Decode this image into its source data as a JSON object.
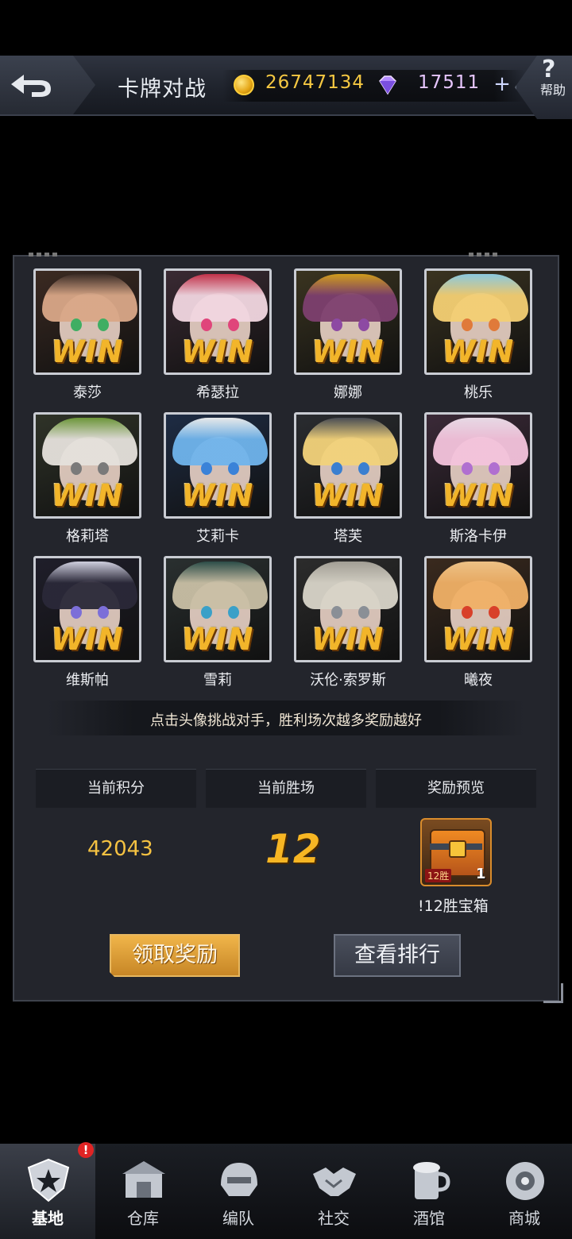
{
  "header": {
    "title": "卡牌对战",
    "gold": "26747134",
    "gems": "17511",
    "add_label": "+",
    "help_symbol": "?",
    "help_label": "帮助"
  },
  "opponents": [
    {
      "name": "泰莎",
      "badge": "WIN"
    },
    {
      "name": "希瑟拉",
      "badge": "WIN"
    },
    {
      "name": "娜娜",
      "badge": "WIN"
    },
    {
      "name": "桃乐",
      "badge": "WIN"
    },
    {
      "name": "格莉塔",
      "badge": "WIN"
    },
    {
      "name": "艾莉卡",
      "badge": "WIN"
    },
    {
      "name": "塔芙",
      "badge": "WIN"
    },
    {
      "name": "斯洛卡伊",
      "badge": "WIN"
    },
    {
      "name": "维斯帕",
      "badge": "WIN"
    },
    {
      "name": "雪莉",
      "badge": "WIN"
    },
    {
      "name": "沃伦·索罗斯",
      "badge": "WIN"
    },
    {
      "name": "曦夜",
      "badge": "WIN"
    }
  ],
  "hint": "点击头像挑战对手，胜利场次越多奖励越好",
  "stats": {
    "score_label": "当前积分",
    "wins_label": "当前胜场",
    "reward_label": "奖励预览",
    "score": "42043",
    "wins": "12",
    "reward_tag": "12胜",
    "reward_qty": "1",
    "reward_name": "!12胜宝箱"
  },
  "buttons": {
    "claim": "领取奖励",
    "ranking": "查看排行"
  },
  "nav": [
    {
      "label": "基地",
      "icon": "base-star-icon",
      "active": true
    },
    {
      "label": "仓库",
      "icon": "warehouse-icon"
    },
    {
      "label": "编队",
      "icon": "helmet-icon"
    },
    {
      "label": "社交",
      "icon": "handshake-icon"
    },
    {
      "label": "酒馆",
      "icon": "beer-mug-icon"
    },
    {
      "label": "商城",
      "icon": "shop-icon"
    }
  ],
  "nav_alert": "!",
  "colors": {
    "gold": "#f5c842",
    "gem": "#e7c6ff",
    "win": "#f2b52a",
    "panel": "#23252c",
    "claim_button": "#e0a23a"
  }
}
